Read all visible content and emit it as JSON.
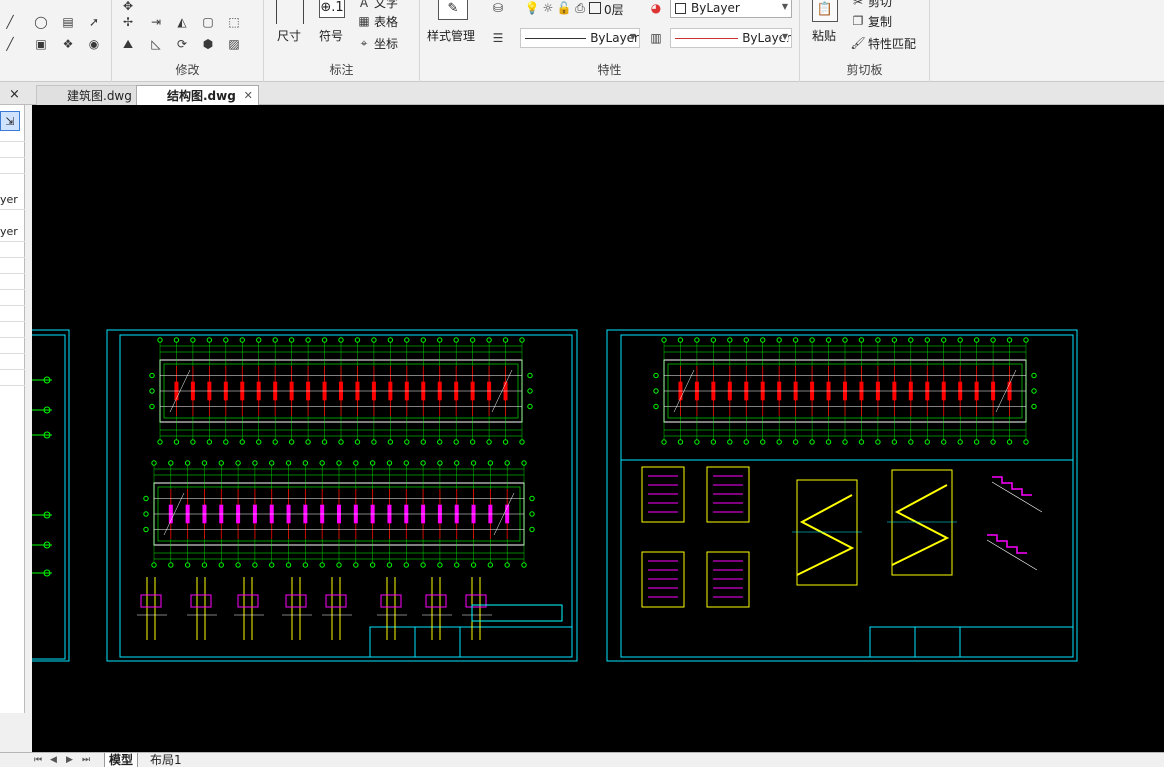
{
  "ribbon": {
    "modify_group": {
      "label": "修改"
    },
    "annotation_group": {
      "label": "标注",
      "dimension": "尺寸",
      "symbol": "符号",
      "text": "文字",
      "table": "表格",
      "coordinate": "坐标"
    },
    "properties_group": {
      "label": "特性",
      "style_manager": "样式管理",
      "layer": "0层",
      "color": "ByLayer",
      "linetype": "ByLayer",
      "lineweight": "ByLayer"
    },
    "clipboard_group": {
      "label": "剪切板",
      "paste": "粘贴",
      "cut": "剪切",
      "copy": "复制",
      "match_properties": "特性匹配"
    }
  },
  "tabs": {
    "close": "×",
    "items": [
      {
        "label": "建筑图.dwg",
        "active": false
      },
      {
        "label": "结构图.dwg",
        "active": true
      }
    ]
  },
  "left_panel": {
    "row1": "yer",
    "row2": "yer"
  },
  "status": {
    "model_tab": "模型",
    "layout_tab": "布局1",
    "nav": [
      "⏮",
      "◀",
      "▶",
      "⏭"
    ]
  },
  "colors": {
    "canvas_bg": "#000000",
    "frame": "#00ffff",
    "green": "#00ff00",
    "red": "#ff0000",
    "magenta": "#ff00ff",
    "yellow": "#ffff00",
    "white": "#ffffff"
  },
  "icons": [
    "line-icon",
    "circle-icon",
    "rect-icon",
    "move-icon",
    "trim-icon",
    "mirror-icon",
    "rotate-icon",
    "scale-icon",
    "dimension-icon",
    "symbol-icon",
    "text-icon",
    "table-icon",
    "coordinate-icon",
    "style-manager-icon",
    "bulb-icon",
    "sun-icon",
    "lock-icon",
    "print-icon",
    "color-wheel-icon",
    "paste-icon",
    "cut-icon",
    "copy-icon",
    "match-icon"
  ]
}
